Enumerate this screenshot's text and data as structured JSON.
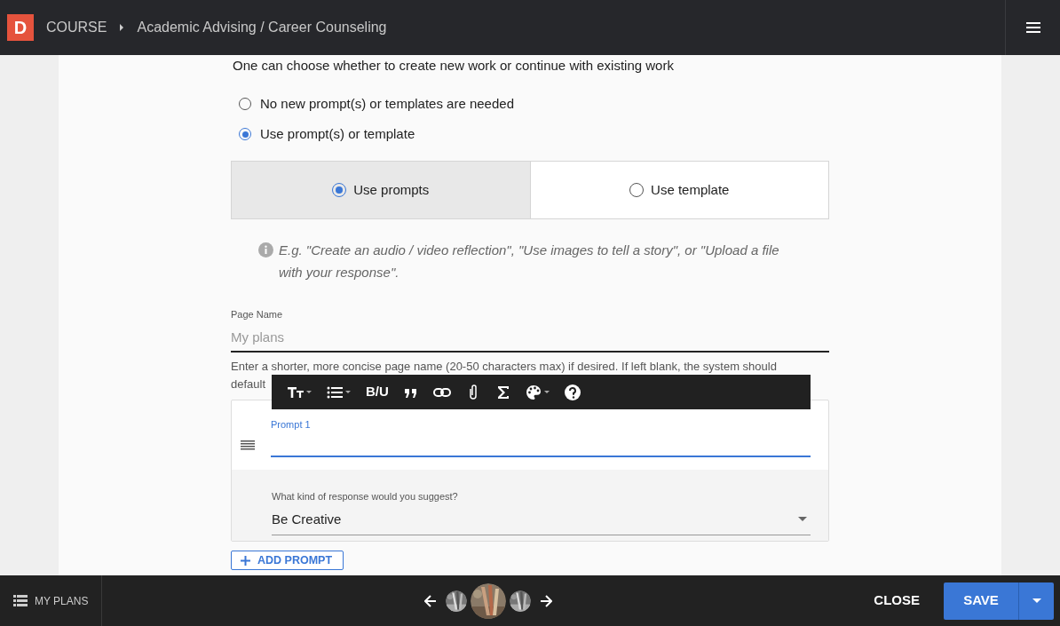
{
  "header": {
    "logo": "D",
    "breadcrumb": [
      {
        "label": "COURSE"
      },
      {
        "label": "Academic Advising / Career Counseling"
      }
    ]
  },
  "intro": "One can choose whether to create new work or continue with existing work",
  "options": [
    {
      "label": "No new prompt(s) or templates are needed",
      "selected": false
    },
    {
      "label": "Use prompt(s) or template",
      "selected": true
    }
  ],
  "mode_tabs": [
    {
      "label": "Use prompts",
      "selected": true
    },
    {
      "label": "Use template",
      "selected": false
    }
  ],
  "info_text": "E.g. \"Create an audio / video reflection\", \"Use images to tell a story\", or \"Upload a file with your response\".",
  "page_name": {
    "label": "Page Name",
    "placeholder": "My plans"
  },
  "page_name_hint": [
    "Enter a shorter, more concise page name (20-50 characters max) if desired. If left blank, the system should",
    "default"
  ],
  "editor_toolbar": {
    "format_label": "B/U"
  },
  "prompts": [
    {
      "label": "Prompt 1",
      "focused": true,
      "question": "What kind of response would you suggest?",
      "response_type": "Be Creative"
    }
  ],
  "add_prompt": "ADD PROMPT",
  "footer": {
    "my_plans": "MY PLANS",
    "thumbnails": [
      {
        "kind": "picture",
        "current": false
      },
      {
        "kind": "picture",
        "current": true
      },
      {
        "kind": "picture",
        "current": false
      }
    ],
    "close": "CLOSE",
    "save": "SAVE"
  }
}
